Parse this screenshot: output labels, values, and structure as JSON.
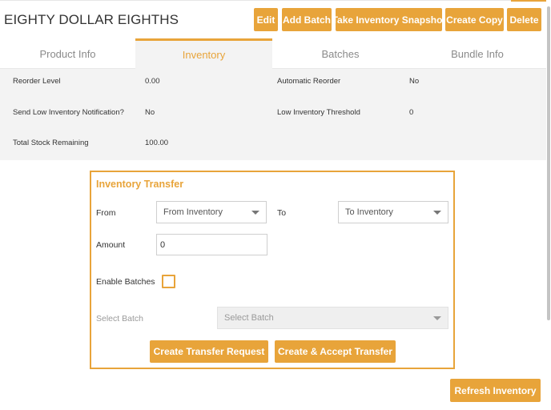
{
  "header": {
    "title": "EIGHTY DOLLAR EIGHTHS",
    "buttons": {
      "edit": "Edit",
      "add_batch": "Add Batch",
      "snapshot": "Take Inventory Snapshot",
      "copy": "Create Copy",
      "delete": "Delete"
    }
  },
  "tabs": [
    {
      "label": "Product Info",
      "active": false
    },
    {
      "label": "Inventory",
      "active": true
    },
    {
      "label": "Batches",
      "active": false
    },
    {
      "label": "Bundle Info",
      "active": false
    }
  ],
  "info": {
    "reorder_level_label": "Reorder Level",
    "reorder_level_value": "0.00",
    "auto_reorder_label": "Automatic Reorder",
    "auto_reorder_value": "No",
    "low_notify_label": "Send Low Inventory Notification?",
    "low_notify_value": "No",
    "low_threshold_label": "Low Inventory Threshold",
    "low_threshold_value": "0",
    "total_stock_label": "Total Stock Remaining",
    "total_stock_value": "100.00"
  },
  "transfer": {
    "title": "Inventory Transfer",
    "from_label": "From",
    "from_value": "From Inventory",
    "to_label": "To",
    "to_value": "To Inventory",
    "amount_label": "Amount",
    "amount_value": "0",
    "enable_batches_label": "Enable Batches",
    "enable_batches_checked": false,
    "select_batch_label": "Select Batch",
    "select_batch_placeholder": "Select Batch",
    "create_request": "Create Transfer Request",
    "create_accept": "Create & Accept Transfer"
  },
  "refresh_inventory": "Refresh Inventory",
  "colors": {
    "accent": "#e8a43a",
    "panel_bg": "#f3f3f3"
  }
}
